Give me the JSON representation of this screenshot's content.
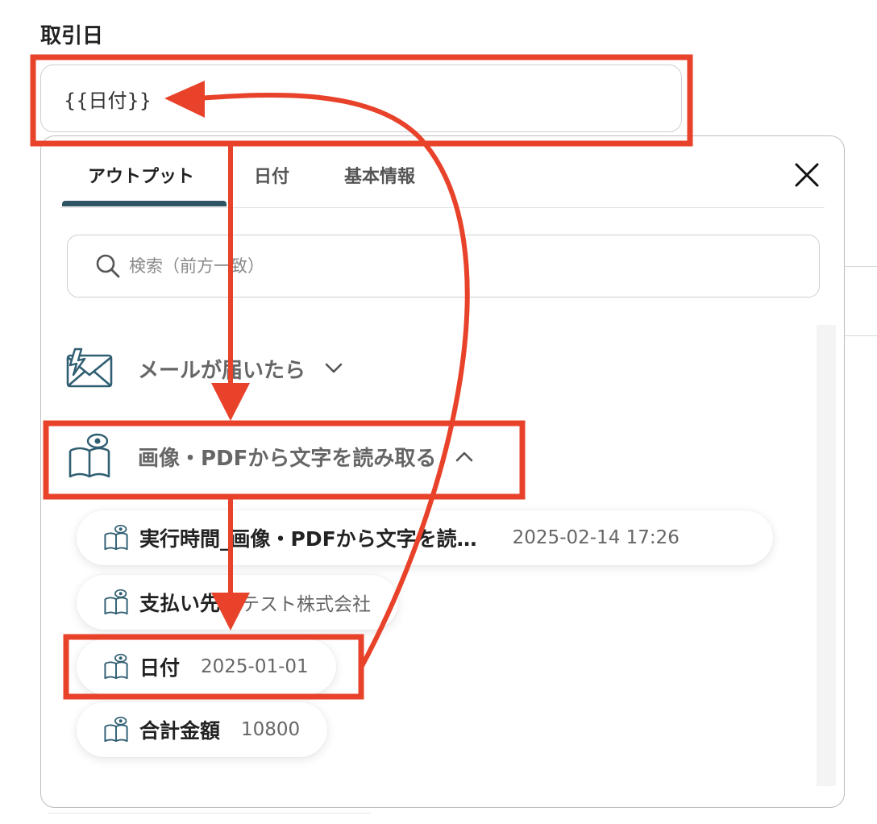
{
  "field": {
    "label": "取引日",
    "value": "{{日付}}"
  },
  "popup": {
    "tabs": [
      {
        "label": "アウトプット",
        "active": true
      },
      {
        "label": "日付",
        "active": false
      },
      {
        "label": "基本情報",
        "active": false
      }
    ],
    "search_placeholder": "検索（前方一致）",
    "sections": [
      {
        "title": "メールが届いたら",
        "icon": "mail-lightning-icon",
        "expanded": false
      },
      {
        "title": "画像・PDFから文字を読み取る",
        "icon": "book-eye-icon",
        "expanded": true
      }
    ],
    "items": [
      {
        "label": "実行時間_画像・PDFから文字を読…",
        "value": "2025-02-14 17:26"
      },
      {
        "label": "支払い先",
        "value": "テスト株式会社"
      },
      {
        "label": "日付",
        "value": "2025-01-01"
      },
      {
        "label": "合計金額",
        "value": "10800"
      }
    ]
  },
  "colors": {
    "annotation_red": "#e8422a",
    "tab_accent": "#2f5466",
    "icon_teal": "#2f5e72"
  }
}
